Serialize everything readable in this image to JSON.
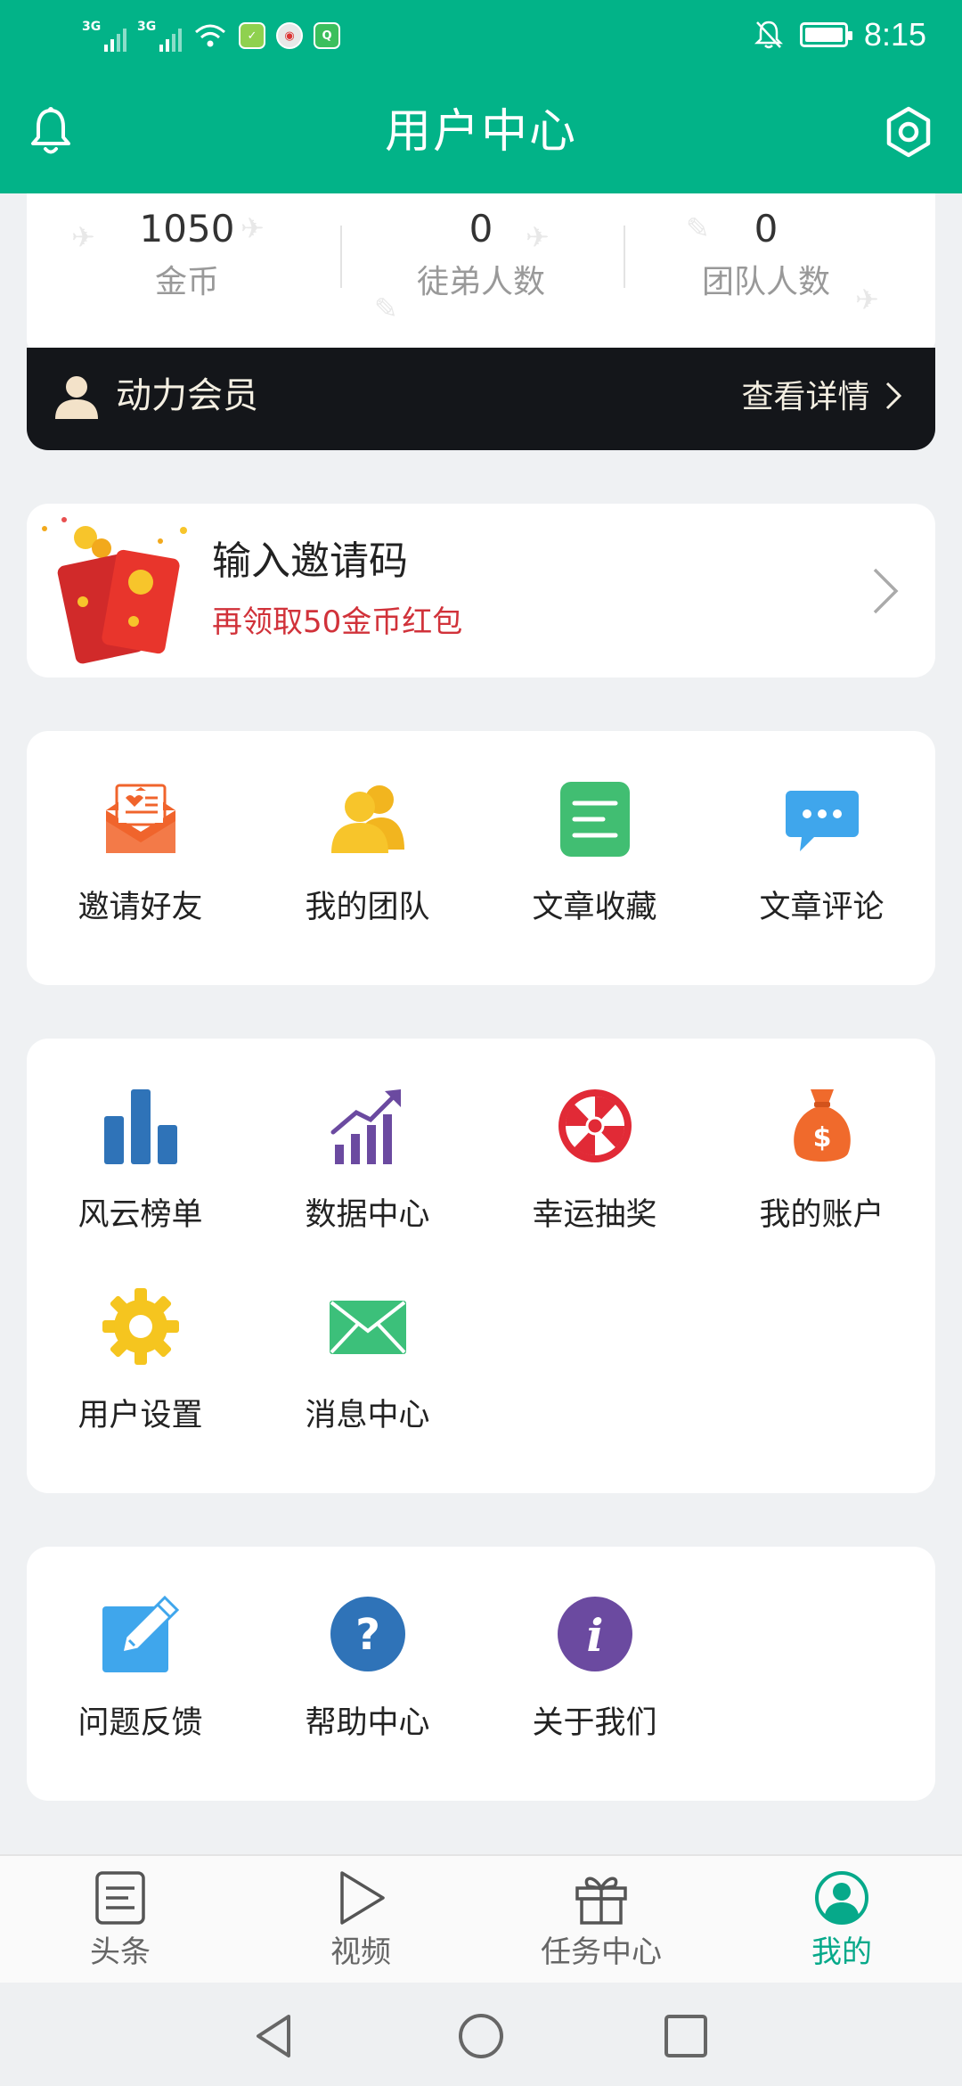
{
  "status_bar": {
    "network_1": "3G",
    "network_2": "3G",
    "time": "8:15"
  },
  "header": {
    "title": "用户中心",
    "left_icon": "bell-icon",
    "right_icon": "settings-icon"
  },
  "stats": [
    {
      "value": "1050",
      "label": "金币"
    },
    {
      "value": "0",
      "label": "徒弟人数"
    },
    {
      "value": "0",
      "label": "团队人数"
    }
  ],
  "member": {
    "title": "动力会员",
    "detail_label": "查看详情"
  },
  "invite": {
    "title": "输入邀请码",
    "subtitle": "再领取50金币红包"
  },
  "grid_a": [
    {
      "label": "邀请好友",
      "icon": "invite-mail-icon",
      "color": "#f0642c"
    },
    {
      "label": "我的团队",
      "icon": "team-icon",
      "color": "#f7c52b"
    },
    {
      "label": "文章收藏",
      "icon": "bookmark-doc-icon",
      "color": "#41be72"
    },
    {
      "label": "文章评论",
      "icon": "comment-icon",
      "color": "#3fa6ec"
    }
  ],
  "grid_b": [
    {
      "label": "风云榜单",
      "icon": "bar-chart-icon",
      "color": "#2f73b8"
    },
    {
      "label": "数据中心",
      "icon": "growth-chart-icon",
      "color": "#6b4aa0"
    },
    {
      "label": "幸运抽奖",
      "icon": "lucky-wheel-icon",
      "color": "#e12a36"
    },
    {
      "label": "我的账户",
      "icon": "money-bag-icon",
      "color": "#f06a2c"
    },
    {
      "label": "用户设置",
      "icon": "gear-icon",
      "color": "#f5c51f"
    },
    {
      "label": "消息中心",
      "icon": "envelope-icon",
      "color": "#3cc07a"
    }
  ],
  "grid_c": [
    {
      "label": "问题反馈",
      "icon": "edit-icon",
      "color": "#3fa6ec"
    },
    {
      "label": "帮助中心",
      "icon": "help-icon",
      "color": "#2f73b8"
    },
    {
      "label": "关于我们",
      "icon": "info-icon",
      "color": "#6b4aa0"
    }
  ],
  "tabs": [
    {
      "label": "头条",
      "icon": "news-icon",
      "active": false
    },
    {
      "label": "视频",
      "icon": "play-icon",
      "active": false
    },
    {
      "label": "任务中心",
      "icon": "gift-icon",
      "active": false
    },
    {
      "label": "我的",
      "icon": "profile-icon",
      "active": true
    }
  ],
  "colors": {
    "primary": "#02b388",
    "active_tab": "#06a98a",
    "invite_subtitle": "#d1323a",
    "member_bar": "#14161a"
  }
}
